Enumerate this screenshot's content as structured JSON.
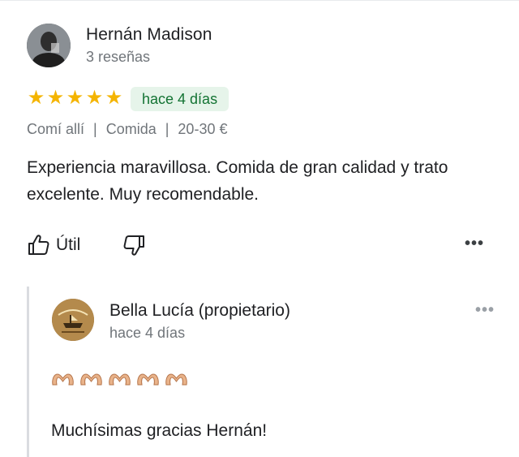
{
  "review": {
    "reviewer_name": "Hernán Madison",
    "reviewer_reviews": "3 reseñas",
    "rating": 5,
    "time_ago": "hace 4 días",
    "meta": [
      "Comí allí",
      "Comida",
      "20-30 €"
    ],
    "text": "Experiencia maravillosa. Comida de gran calidad y trato excelente. Muy recomendable.",
    "helpful_label": "Útil",
    "more_label": "•••"
  },
  "owner_reply": {
    "name": "Bella Lucía (propietario)",
    "time_ago": "hace 4 días",
    "emoji_count": 5,
    "text": "Muchísimas gracias Hernán!",
    "more_label": "•••"
  },
  "colors": {
    "star": "#f4b400",
    "badge_bg": "#e6f4ea",
    "badge_text": "#137333",
    "secondary_text": "#70757a"
  }
}
